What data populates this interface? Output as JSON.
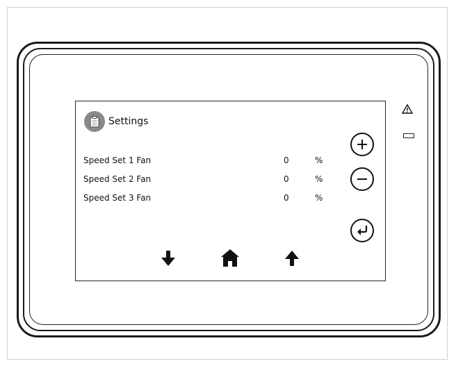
{
  "screen": {
    "title": "Settings",
    "title_icon": "clipboard-icon",
    "rows": [
      {
        "label": "Speed Set 1 Fan",
        "value": "0",
        "unit": "%"
      },
      {
        "label": "Speed Set 2 Fan",
        "value": "0",
        "unit": "%"
      },
      {
        "label": "Speed Set 3 Fan",
        "value": "0",
        "unit": "%"
      }
    ],
    "buttons": {
      "plus_icon": "plus-icon",
      "minus_icon": "minus-icon",
      "enter_icon": "enter-icon"
    },
    "nav": {
      "down_icon": "arrow-down-icon",
      "home_icon": "home-icon",
      "up_icon": "arrow-up-icon"
    }
  },
  "device": {
    "warning_indicator_icon": "warning-triangle-icon",
    "status_indicator": "status-led"
  },
  "colors": {
    "outline": "#1a1a1a",
    "icon_badge": "#8a8a8a",
    "background": "#ffffff"
  }
}
